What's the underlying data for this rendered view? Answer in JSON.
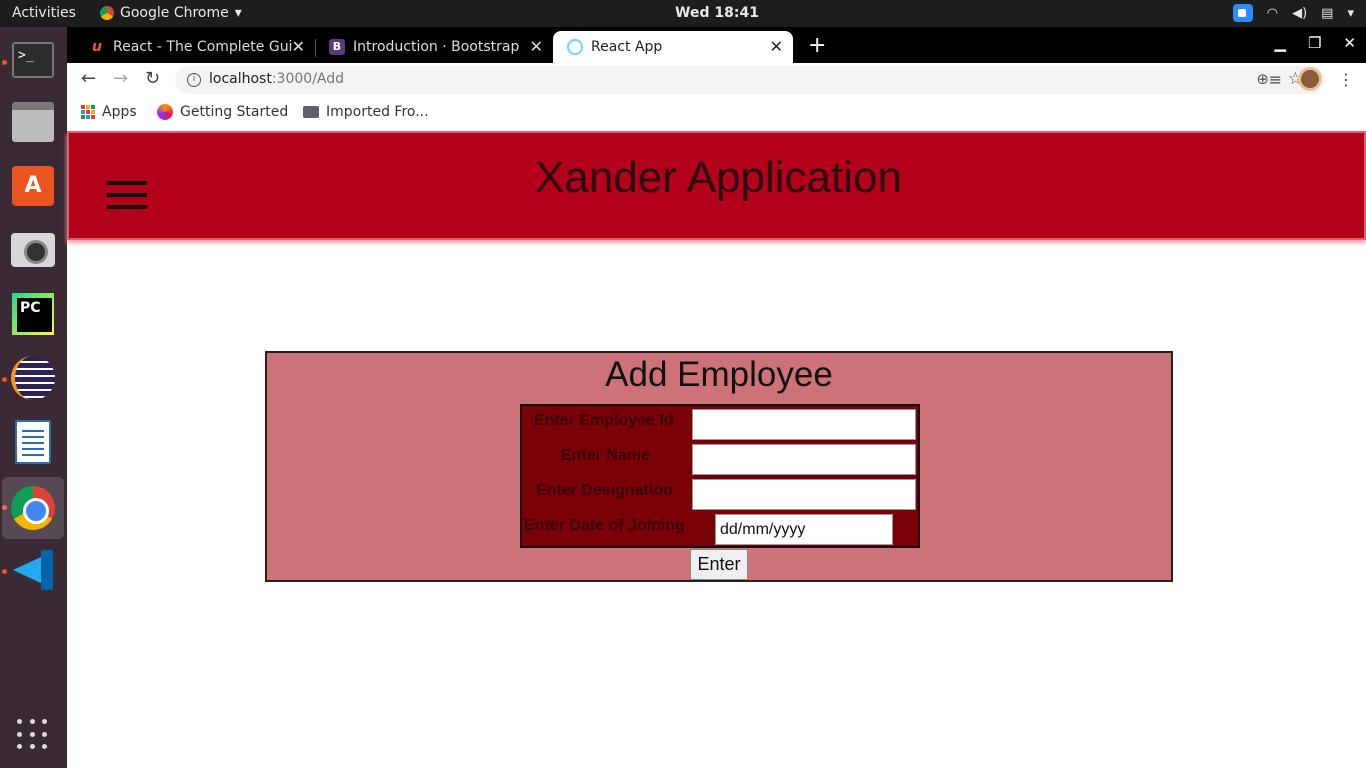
{
  "system": {
    "activities": "Activities",
    "app_name": "Google Chrome",
    "clock": "Wed 18:41"
  },
  "browser": {
    "tabs": [
      {
        "title": "React - The Complete Guide",
        "favicon": "udemy-icon",
        "active": false
      },
      {
        "title": "Introduction · Bootstrap v",
        "favicon": "bootstrap-icon",
        "active": false
      },
      {
        "title": "React App",
        "favicon": "react-icon",
        "active": true
      }
    ],
    "url_host": "localhost",
    "url_path": ":3000/Add",
    "bookmarks": [
      {
        "label": "Apps",
        "icon": "apps-grid-icon"
      },
      {
        "label": "Getting Started",
        "icon": "firefox-icon"
      },
      {
        "label": "Imported Fro...",
        "icon": "folder-icon"
      }
    ]
  },
  "app": {
    "title": "Xander Application",
    "header_color": "#b3001b",
    "form": {
      "title": "Add Employee",
      "fields": [
        {
          "label": "Enter Employee Id",
          "value": ""
        },
        {
          "label": "Enter Name",
          "value": ""
        },
        {
          "label": "Enter Designation",
          "value": ""
        },
        {
          "label": "Enter Date of Joining",
          "value": "dd/mm/yyyy"
        }
      ],
      "submit_label": "Enter"
    }
  }
}
